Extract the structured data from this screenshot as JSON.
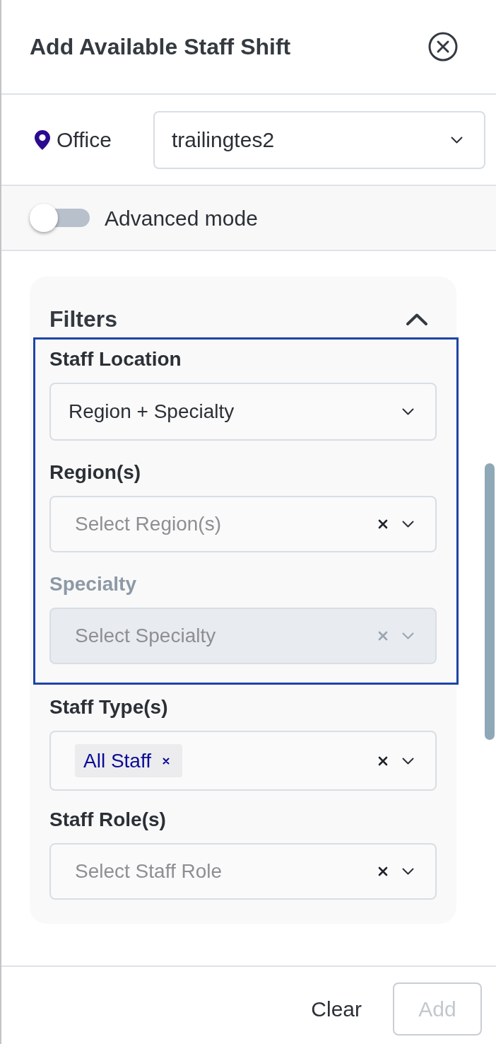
{
  "header": {
    "title": "Add Available Staff Shift"
  },
  "office": {
    "label": "Office",
    "value": "trailingtes2"
  },
  "advanced_mode": {
    "label": "Advanced mode",
    "on": false
  },
  "filters": {
    "title": "Filters",
    "expanded": true,
    "sections": [
      {
        "highlighted": true,
        "fields": [
          {
            "label": "Staff Location",
            "kind": "single",
            "value": "Region + Specialty",
            "disabled": false
          },
          {
            "label": "Region(s)",
            "kind": "multi",
            "placeholder": "Select Region(s)",
            "disabled": false
          },
          {
            "label": "Specialty",
            "kind": "multi",
            "placeholder": "Select Specialty",
            "disabled": true
          }
        ]
      },
      {
        "highlighted": false,
        "fields": [
          {
            "label": "Staff Type(s)",
            "kind": "multi",
            "chips": [
              "All Staff"
            ],
            "disabled": false
          },
          {
            "label": "Staff Role(s)",
            "kind": "multi",
            "placeholder": "Select Staff Role",
            "disabled": false
          }
        ]
      }
    ]
  },
  "footer": {
    "buttons": [
      {
        "label": "Clear",
        "kind": "text",
        "disabled": false
      },
      {
        "label": "Add",
        "kind": "outline",
        "disabled": true
      }
    ]
  }
}
